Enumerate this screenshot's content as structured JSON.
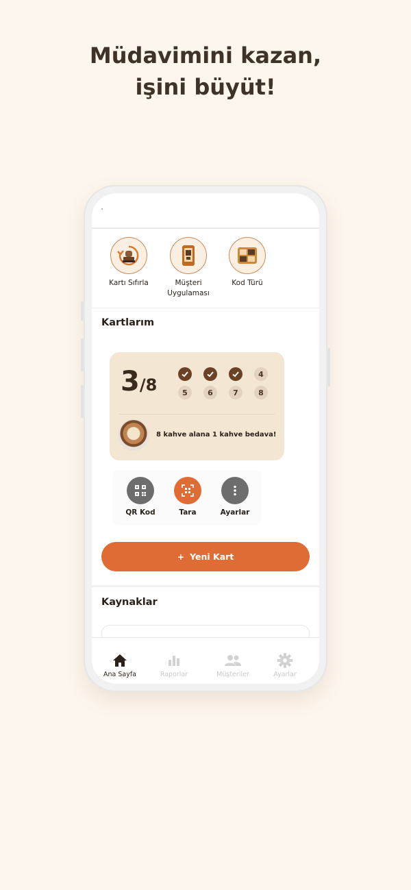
{
  "headline": {
    "line1": "Müdavimini kazan,",
    "line2": "işini büyüt!"
  },
  "quick_actions": [
    {
      "label": "Kartı Sıfırla",
      "icon": "stamp-reset-icon"
    },
    {
      "label": "Müşteri Uygulaması",
      "icon": "customer-app-icon"
    },
    {
      "label": "Kod Türü",
      "icon": "code-type-icon"
    }
  ],
  "cards_section": {
    "title": "Kartlarım"
  },
  "loyalty_card": {
    "stamped": "3",
    "total": "8",
    "stamps": [
      {
        "num": "1",
        "done": true
      },
      {
        "num": "2",
        "done": true
      },
      {
        "num": "3",
        "done": true
      },
      {
        "num": "4",
        "done": false
      },
      {
        "num": "5",
        "done": false
      },
      {
        "num": "6",
        "done": false
      },
      {
        "num": "7",
        "done": false
      },
      {
        "num": "8",
        "done": false
      }
    ],
    "promo_text": "8 kahve alana 1 kahve bedava!",
    "colors": {
      "card_bg": "#f3e6d3",
      "stamp_done": "#6b4225",
      "stamp_todo": "#e3d2bd"
    }
  },
  "card_actions": [
    {
      "label": "QR Kod",
      "icon": "qr-code-icon",
      "color": "#6d6d6d"
    },
    {
      "label": "Tara",
      "icon": "scan-icon",
      "color": "#e06c35"
    },
    {
      "label": "Ayarlar",
      "icon": "more-vertical-icon",
      "color": "#6d6d6d"
    }
  ],
  "new_card_button": {
    "icon": "+",
    "label": "Yeni Kart"
  },
  "resources_section": {
    "title": "Kaynaklar"
  },
  "tabbar": [
    {
      "label": "Ana Sayfa",
      "icon": "home-icon",
      "active": true
    },
    {
      "label": "Raporlar",
      "icon": "bar-chart-icon",
      "active": false
    },
    {
      "label": "Müşteriler",
      "icon": "users-icon",
      "active": false
    },
    {
      "label": "Ayarlar",
      "icon": "gear-icon",
      "active": false
    }
  ],
  "colors": {
    "page_bg": "#fdf6ec",
    "accent": "#e06c35",
    "text": "#2b2118"
  }
}
